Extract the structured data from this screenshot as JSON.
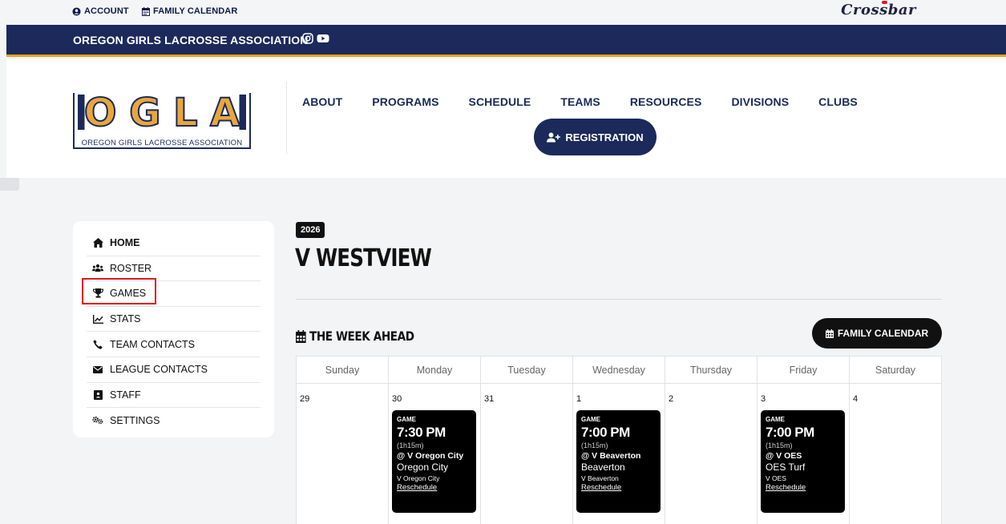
{
  "utility": {
    "account": "ACCOUNT",
    "family_calendar": "FAMILY CALENDAR",
    "brand": "Crossbar"
  },
  "assoc": {
    "name": "OREGON GIRLS LACROSSE ASSOCIATION"
  },
  "logo": {
    "letters": "OGLA",
    "caption": "OREGON GIRLS LACROSSE ASSOCIATION"
  },
  "nav": {
    "items": [
      "ABOUT",
      "PROGRAMS",
      "SCHEDULE",
      "TEAMS",
      "RESOURCES",
      "DIVISIONS",
      "CLUBS"
    ],
    "registration": "REGISTRATION"
  },
  "sidebar": {
    "items": [
      {
        "label": "HOME",
        "icon": "home-icon"
      },
      {
        "label": "ROSTER",
        "icon": "users-icon"
      },
      {
        "label": "GAMES",
        "icon": "trophy-icon"
      },
      {
        "label": "STATS",
        "icon": "chart-line-icon"
      },
      {
        "label": "TEAM CONTACTS",
        "icon": "phone-icon"
      },
      {
        "label": "LEAGUE CONTACTS",
        "icon": "envelope-icon"
      },
      {
        "label": "STAFF",
        "icon": "id-badge-icon"
      },
      {
        "label": "SETTINGS",
        "icon": "cogs-icon"
      }
    ]
  },
  "main": {
    "year": "2026",
    "team_name": "V WESTVIEW",
    "week_title": "THE WEEK AHEAD",
    "family_calendar_button": "FAMILY CALENDAR"
  },
  "calendar": {
    "days": [
      "Sunday",
      "Monday",
      "Tuesday",
      "Wednesday",
      "Thursday",
      "Friday",
      "Saturday"
    ],
    "dates": [
      "29",
      "30",
      "31",
      "1",
      "2",
      "3",
      "4"
    ],
    "events": [
      {
        "type": "GAME",
        "time": "7:30 PM",
        "duration": "(1h15m)",
        "opponent": "@ V Oregon City",
        "location": "Oregon City",
        "team": "V Oregon City",
        "action": "Reschedule"
      },
      {
        "type": "GAME",
        "time": "7:00 PM",
        "duration": "(1h15m)",
        "opponent": "@ V Beaverton",
        "location": "Beaverton",
        "team": "V Beaverton",
        "action": "Reschedule"
      },
      {
        "type": "GAME",
        "time": "7:00 PM",
        "duration": "(1h15m)",
        "opponent": "@ V OES",
        "location": "OES Turf",
        "team": "V OES",
        "action": "Reschedule"
      }
    ]
  },
  "colors": {
    "navy": "#1b2a5a",
    "gold": "#e5a21e",
    "highlight_red": "#e0191e"
  }
}
